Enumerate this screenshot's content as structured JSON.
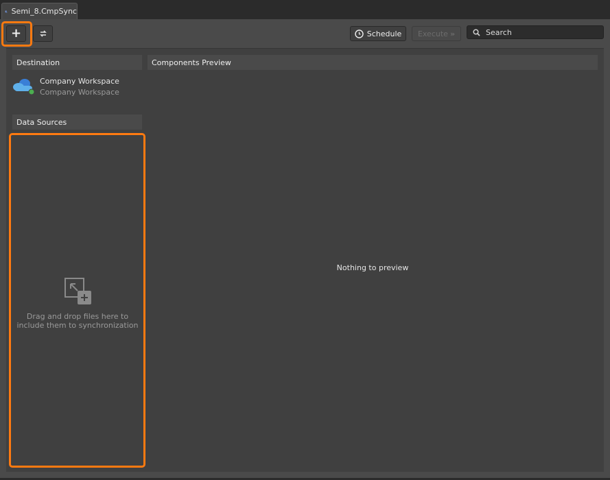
{
  "tab": {
    "title": "Semi_8.CmpSync",
    "icon": "component-sync-icon"
  },
  "toolbar": {
    "add_icon": "plus-icon",
    "sync_icon": "refresh-icon",
    "schedule_label": "Schedule",
    "execute_label": "Execute",
    "search_placeholder": "Search"
  },
  "destination": {
    "header": "Destination",
    "name": "Company Workspace",
    "subtitle": "Company Workspace",
    "status_color": "#4caf50"
  },
  "data_sources": {
    "header": "Data Sources",
    "drop_hint": "Drag and drop files here to include them to synchronization"
  },
  "preview": {
    "header": "Components Preview",
    "empty": "Nothing to preview"
  },
  "colors": {
    "highlight": "#ff7a10"
  }
}
